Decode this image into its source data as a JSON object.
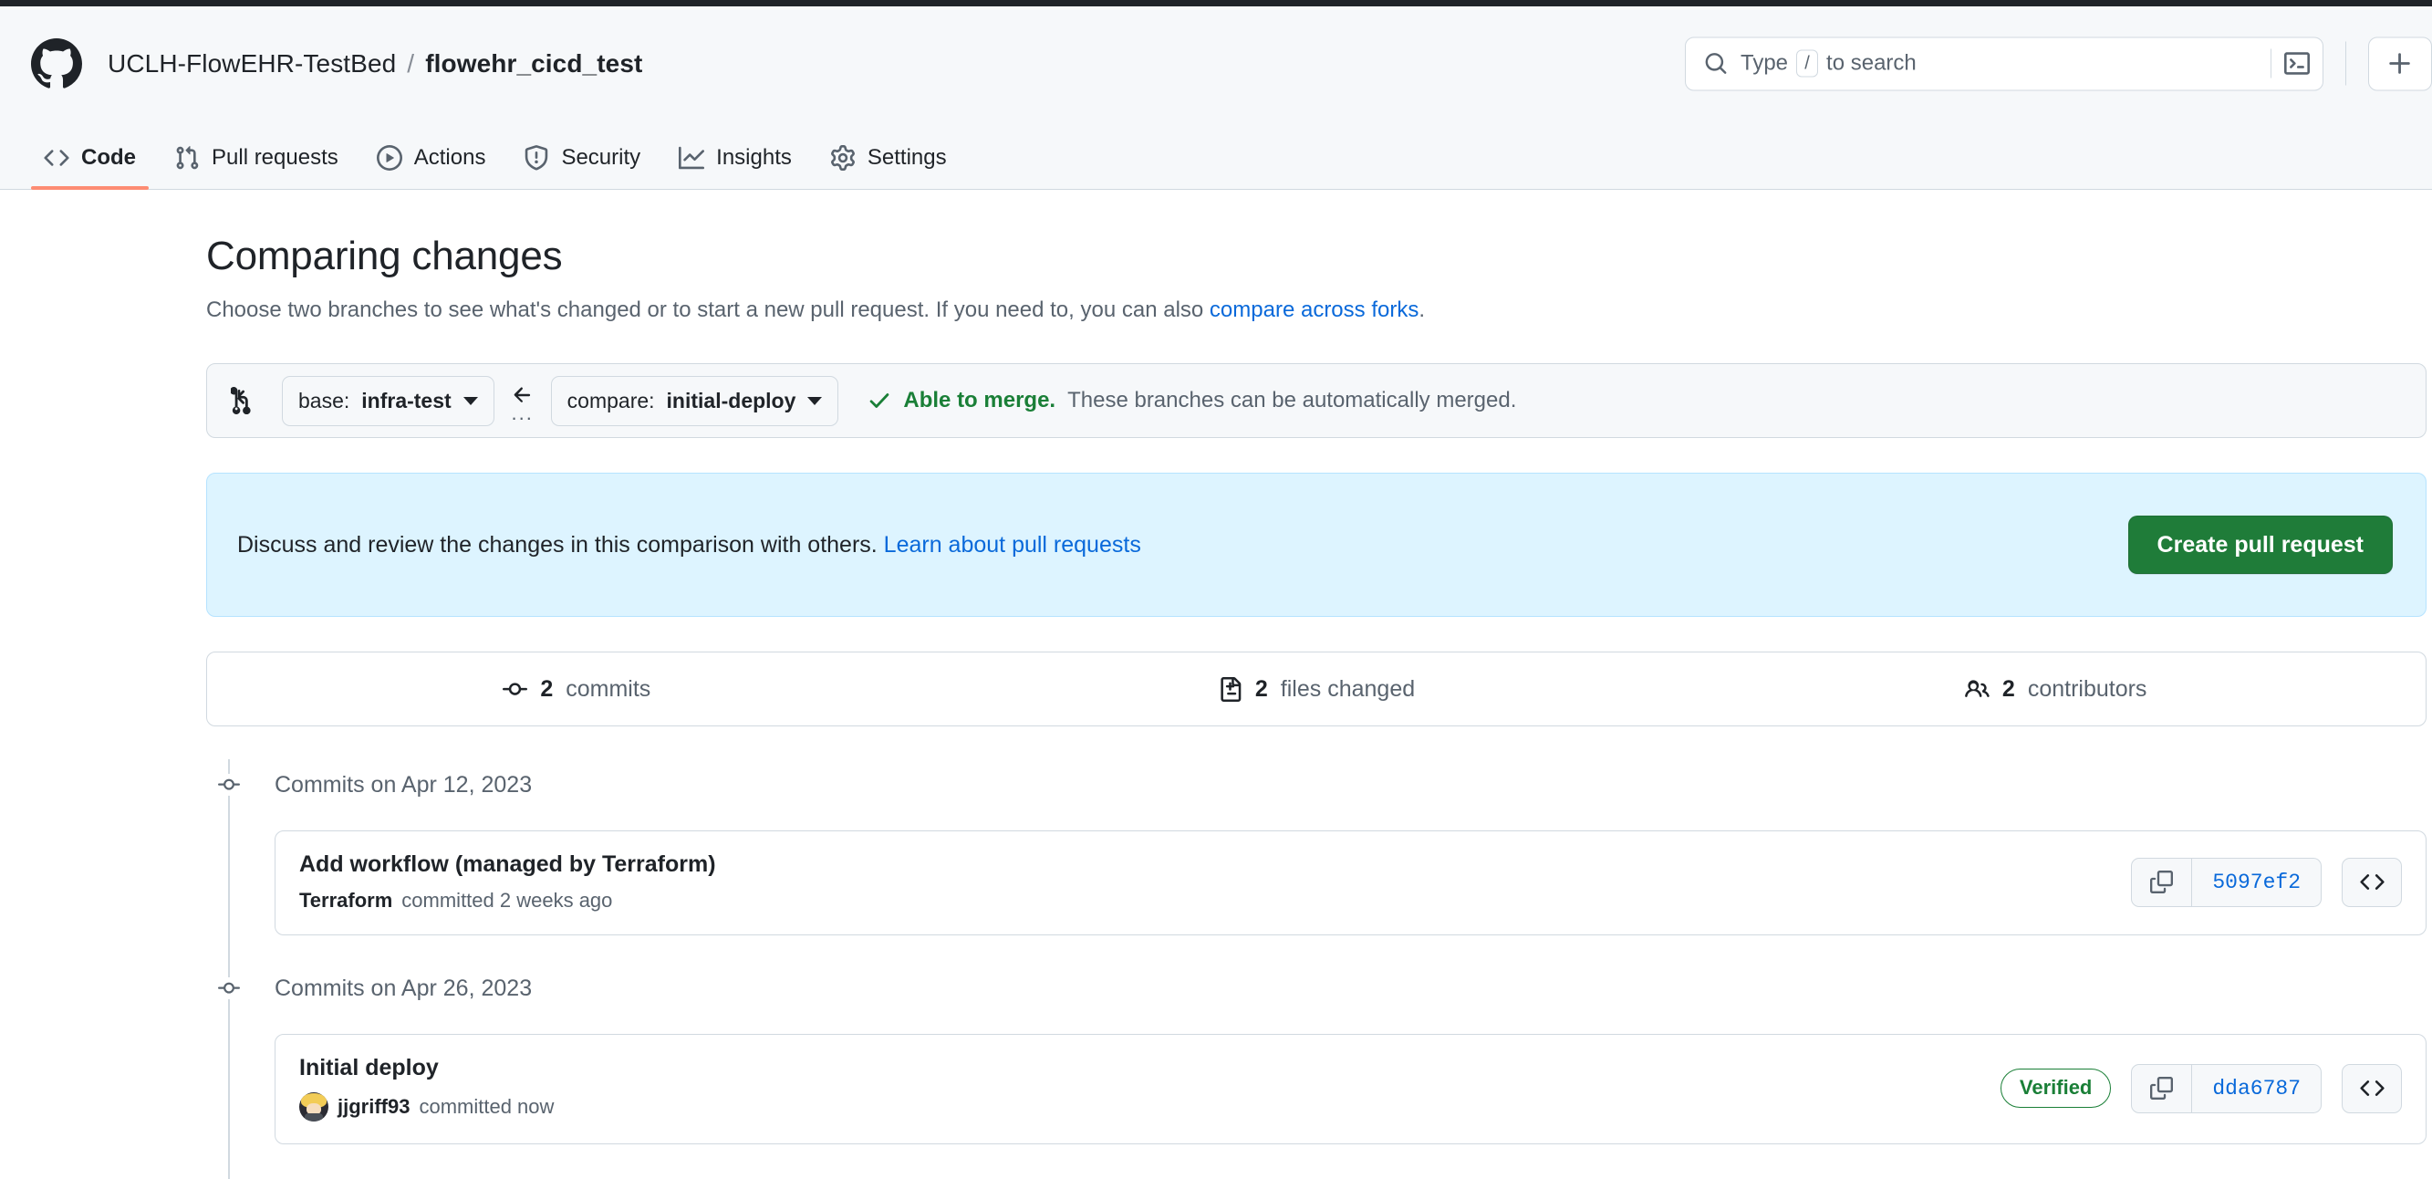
{
  "header": {
    "logo_icon": "github-logo-icon",
    "owner": "UCLH-FlowEHR-TestBed",
    "separator": "/",
    "repo": "flowehr_cicd_test",
    "search": {
      "icon": "search-icon",
      "placeholder_before": "Type",
      "slash_key": "/",
      "placeholder_after": "to search",
      "terminal_icon": "terminal-icon"
    },
    "add_button_icon": "plus-icon"
  },
  "nav": {
    "items": [
      {
        "label": "Code",
        "icon": "code-icon",
        "active": true
      },
      {
        "label": "Pull requests",
        "icon": "git-pull-request-icon",
        "active": false
      },
      {
        "label": "Actions",
        "icon": "play-circle-icon",
        "active": false
      },
      {
        "label": "Security",
        "icon": "shield-icon",
        "active": false
      },
      {
        "label": "Insights",
        "icon": "graph-icon",
        "active": false
      },
      {
        "label": "Settings",
        "icon": "gear-icon",
        "active": false
      }
    ]
  },
  "page": {
    "title": "Comparing changes",
    "subtitle_text": "Choose two branches to see what's changed or to start a new pull request. If you need to, you can also ",
    "subtitle_link": "compare across forks",
    "subtitle_end": "."
  },
  "branch_bar": {
    "compare_icon": "git-compare-icon",
    "base_prefix": "base:",
    "base_branch": "infra-test",
    "arrow_icon": "arrow-left-icon",
    "ellipsis": "...",
    "compare_prefix": "compare:",
    "compare_branch": "initial-deploy",
    "merge_check_icon": "check-icon",
    "merge_status_bold": "Able to merge.",
    "merge_status_rest": "These branches can be automatically merged."
  },
  "banner": {
    "text": "Discuss and review the changes in this comparison with others. ",
    "link": "Learn about pull requests",
    "button_label": "Create pull request",
    "button_color": "#1f7c39",
    "background_color": "#ddf4ff"
  },
  "stats": [
    {
      "icon": "commit-icon",
      "count": "2",
      "label": "commits"
    },
    {
      "icon": "file-diff-icon",
      "count": "2",
      "label": "files changed"
    },
    {
      "icon": "people-icon",
      "count": "2",
      "label": "contributors"
    }
  ],
  "commit_groups": [
    {
      "node_icon": "commit-node-icon",
      "date_label": "Commits on Apr 12, 2023",
      "commits": [
        {
          "title": "Add workflow (managed by Terraform)",
          "author": "Terraform",
          "meta": "committed 2 weeks ago",
          "has_avatar": false,
          "verified": null,
          "copy_icon": "copy-icon",
          "sha": "5097ef2",
          "browse_icon": "code-icon"
        }
      ]
    },
    {
      "node_icon": "commit-node-icon",
      "date_label": "Commits on Apr 26, 2023",
      "commits": [
        {
          "title": "Initial deploy",
          "author": "jjgriff93",
          "meta": "committed now",
          "has_avatar": true,
          "verified": "Verified",
          "copy_icon": "copy-icon",
          "sha": "dda6787",
          "browse_icon": "code-icon"
        }
      ]
    }
  ]
}
